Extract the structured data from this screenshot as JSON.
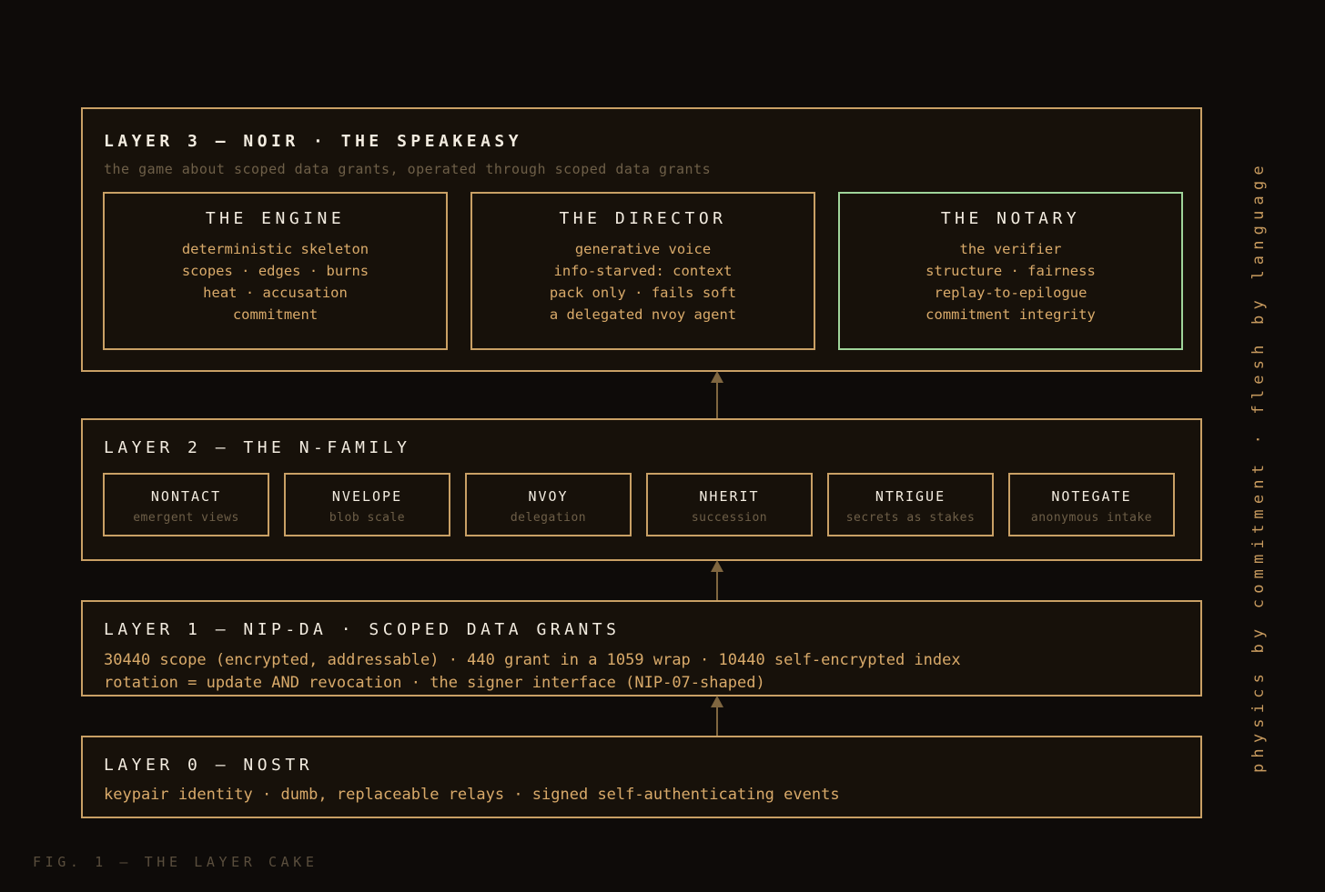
{
  "layers": {
    "layer3": {
      "title": "LAYER 3 — NOIR · THE SPEAKEASY",
      "subtitle": "the game about scoped data grants, operated through scoped data grants",
      "components": [
        {
          "title": "THE ENGINE",
          "lines": [
            "deterministic skeleton",
            "scopes · edges · burns",
            "heat · accusation",
            "commitment"
          ]
        },
        {
          "title": "THE DIRECTOR",
          "lines": [
            "generative voice",
            "info-starved: context",
            "pack only · fails soft",
            "a delegated nvoy agent"
          ]
        },
        {
          "title": "THE NOTARY",
          "lines": [
            "the verifier",
            "structure · fairness",
            "replay-to-epilogue",
            "commitment integrity"
          ]
        }
      ]
    },
    "layer2": {
      "title": "LAYER 2 — THE N-FAMILY",
      "family": [
        {
          "name": "NONTACT",
          "role": "emergent views"
        },
        {
          "name": "NVELOPE",
          "role": "blob scale"
        },
        {
          "name": "NVOY",
          "role": "delegation"
        },
        {
          "name": "NHERIT",
          "role": "succession"
        },
        {
          "name": "NTRIGUE",
          "role": "secrets as stakes"
        },
        {
          "name": "NOTEGATE",
          "role": "anonymous intake"
        }
      ]
    },
    "layer1": {
      "title": "LAYER 1 — NIP-DA · SCOPED DATA GRANTS",
      "lines": [
        "30440 scope (encrypted, addressable) · 440 grant in a 1059 wrap · 10440 self-encrypted index",
        "rotation = update AND revocation · the signer interface (NIP-07-shaped)"
      ]
    },
    "layer0": {
      "title": "LAYER 0 — NOSTR",
      "line": "keypair identity · dumb, replaceable relays · signed self-authenticating events"
    }
  },
  "side_text": "physics by commitment · flesh by language",
  "caption": "FIG. 1 — THE LAYER CAKE",
  "colors": {
    "background": "#0e0b09",
    "panel": "#17110a",
    "border": "#c9a065",
    "accent_border": "#9fd49a",
    "title": "#f3ece0",
    "body": "#d9aa6a",
    "muted": "#6e5f48",
    "arrow": "#7f6640"
  }
}
